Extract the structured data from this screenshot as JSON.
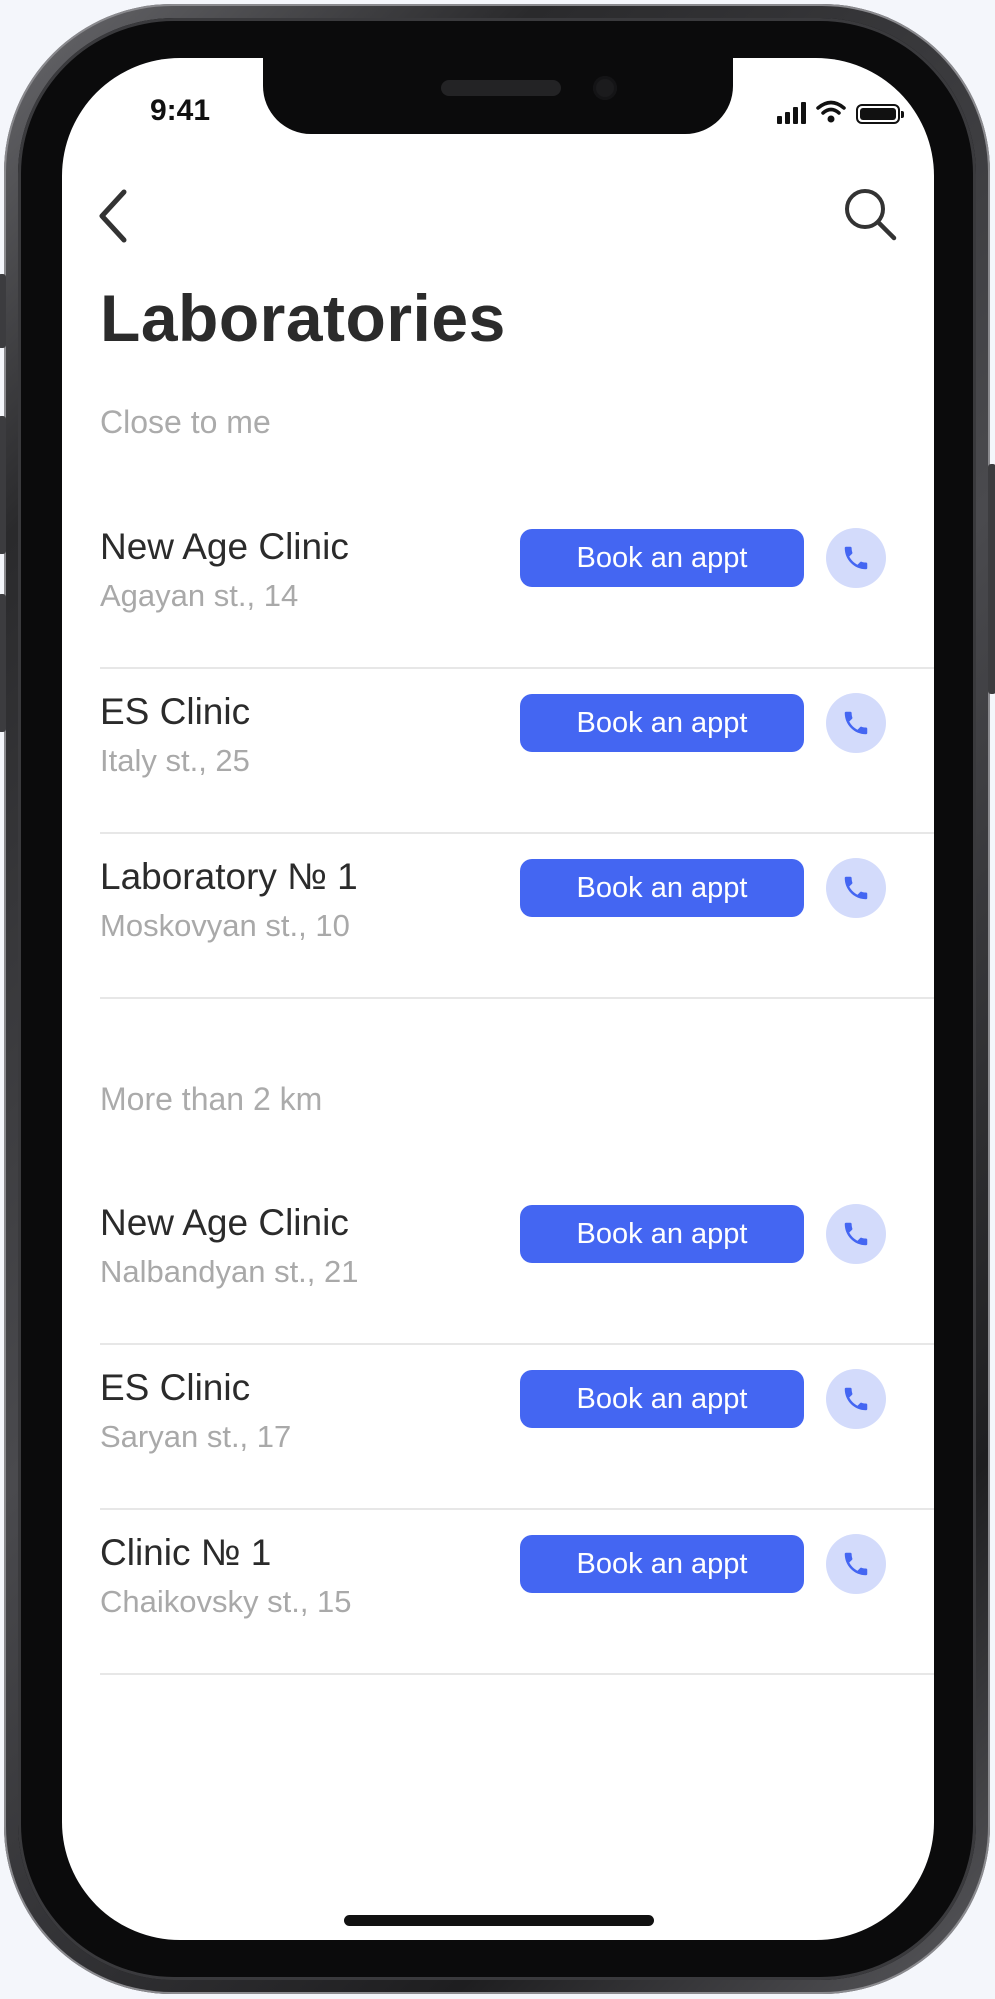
{
  "status_bar": {
    "time": "9:41"
  },
  "header": {
    "title": "Laboratories"
  },
  "sections": [
    {
      "label": "Close to me",
      "items": [
        {
          "name": "New Age Clinic",
          "address": "Agayan st., 14",
          "book_label": "Book an appt"
        },
        {
          "name": "ES Clinic",
          "address": "Italy st., 25",
          "book_label": "Book an appt"
        },
        {
          "name": "Laboratory № 1",
          "address": "Moskovyan st., 10",
          "book_label": "Book an appt"
        }
      ]
    },
    {
      "label": "More than 2 km",
      "items": [
        {
          "name": "New Age Clinic",
          "address": "Nalbandyan st., 21",
          "book_label": "Book an appt"
        },
        {
          "name": "ES Clinic",
          "address": "Saryan st., 17",
          "book_label": "Book an appt"
        },
        {
          "name": "Clinic № 1",
          "address": "Chaikovsky st., 15",
          "book_label": "Book an appt"
        }
      ]
    }
  ],
  "icons": {
    "back": "chevron-left-icon",
    "search": "search-icon",
    "call": "phone-icon",
    "signal": "cellular-signal-icon",
    "wifi": "wifi-icon",
    "battery": "battery-icon"
  },
  "colors": {
    "accent": "#4466f2",
    "call_bg": "#d3dbfb",
    "title_text": "#2b2b2b",
    "secondary_text": "#a9a9a9",
    "divider": "#e7e7e7"
  }
}
